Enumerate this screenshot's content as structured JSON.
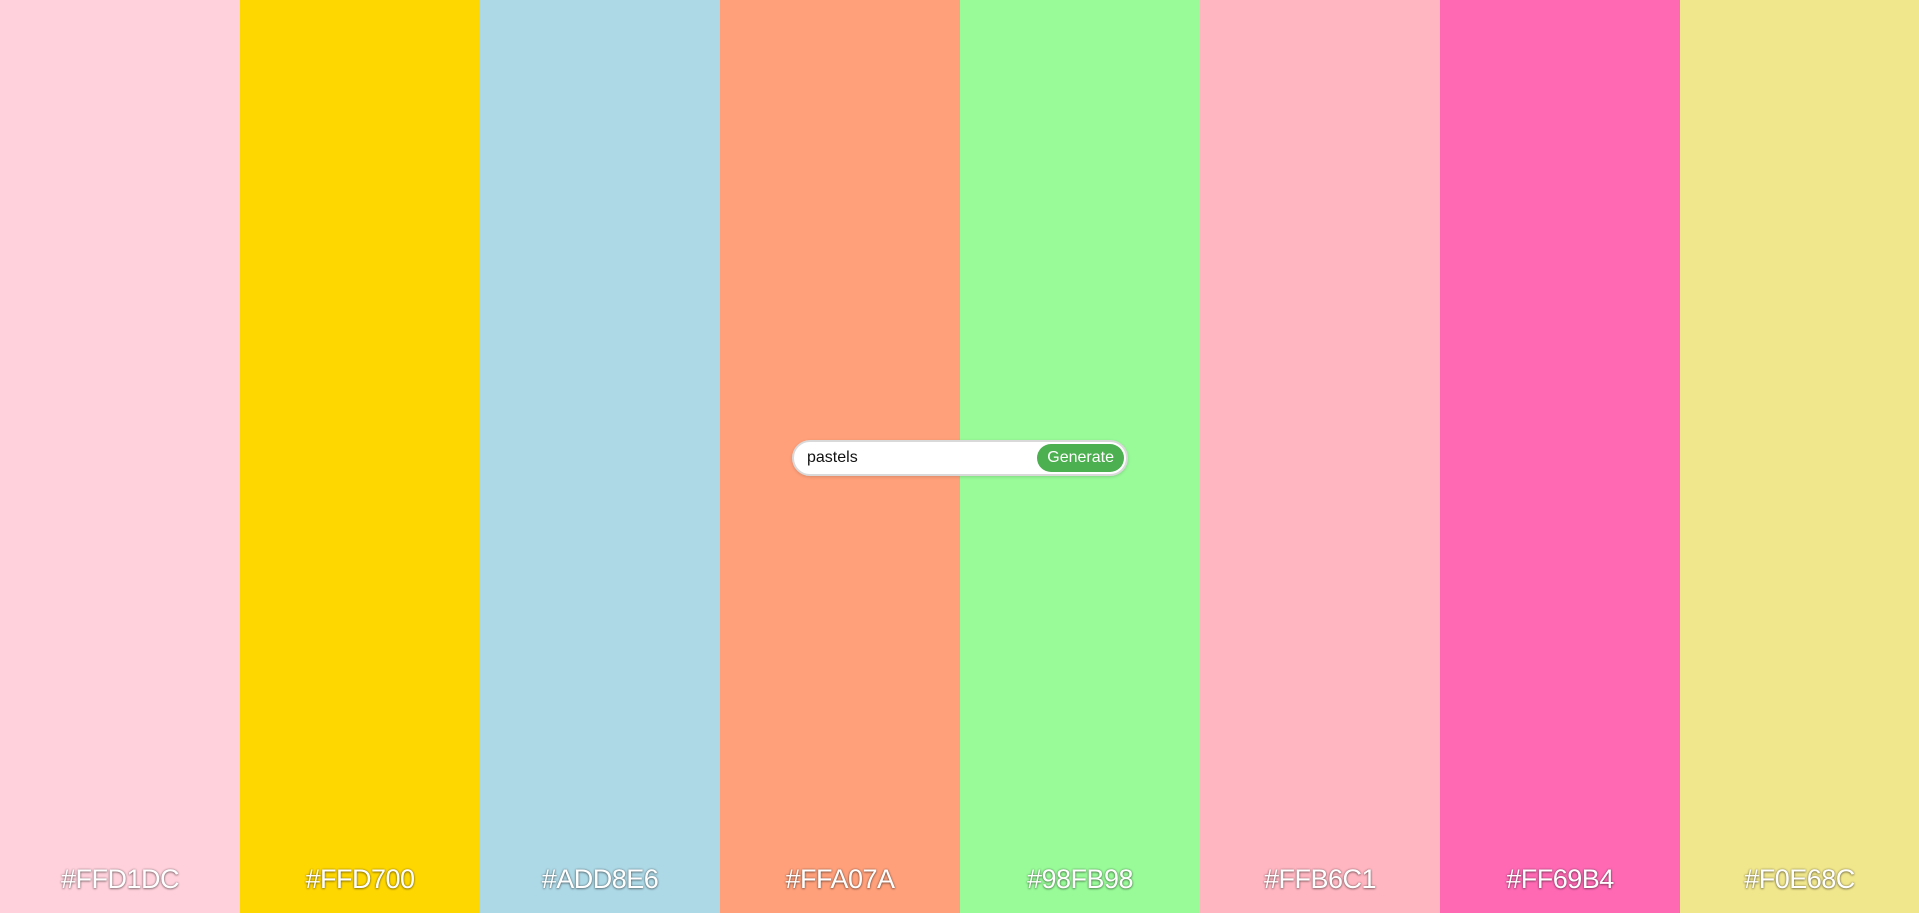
{
  "palette": {
    "colors": [
      {
        "hex": "#FFD1DC",
        "label": "#FFD1DC"
      },
      {
        "hex": "#FFD700",
        "label": "#FFD700"
      },
      {
        "hex": "#ADD8E6",
        "label": "#ADD8E6"
      },
      {
        "hex": "#FFA07A",
        "label": "#FFA07A"
      },
      {
        "hex": "#98FB98",
        "label": "#98FB98"
      },
      {
        "hex": "#FFB6C1",
        "label": "#FFB6C1"
      },
      {
        "hex": "#FF69B4",
        "label": "#FF69B4"
      },
      {
        "hex": "#F0E68C",
        "label": "#F0E68C"
      }
    ]
  },
  "search": {
    "value": "pastels",
    "placeholder": ""
  },
  "generate": {
    "label": "Generate",
    "color": "#4caf50"
  }
}
